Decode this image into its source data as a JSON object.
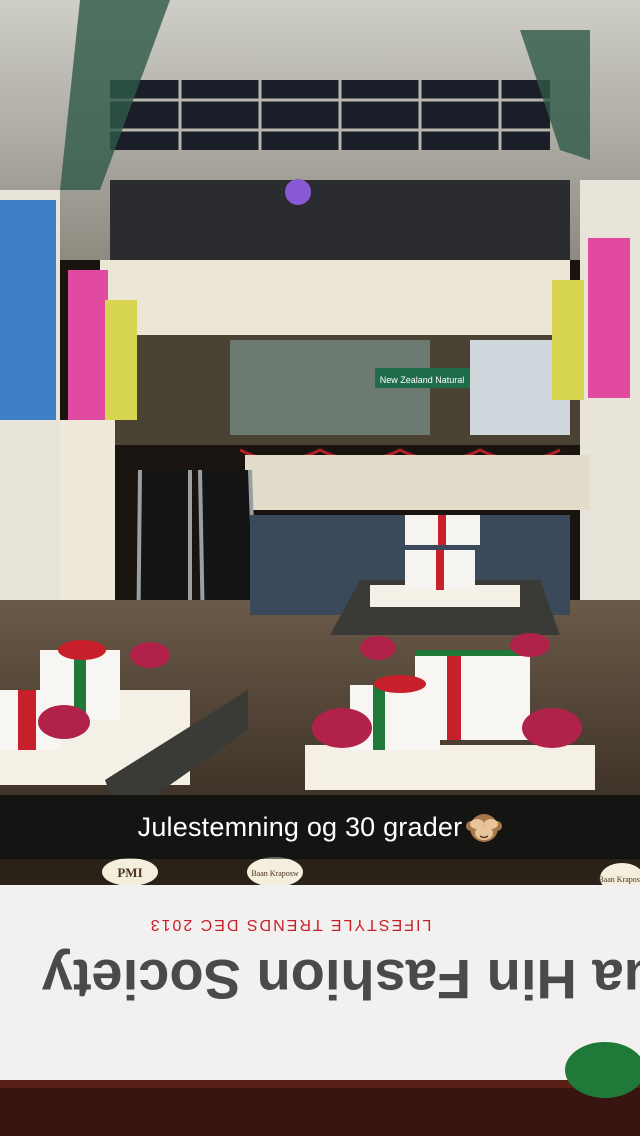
{
  "snap": {
    "caption": "Julestemning og 30 grader",
    "emoji": "see-no-evil-monkey"
  },
  "scene": {
    "store_sign_1": "PMI",
    "store_sign_2": "Baan Kraposw",
    "store_sign_3": "Baan Kraposw",
    "shop_sign": "New Zealand Natural",
    "banner_sub": "LIFESTYLE TRENDS DEC 2013",
    "banner_main_1": "Hua Hin Fashion Society",
    "colors": {
      "gift_red": "#c8202a",
      "gift_green": "#1f7a3a",
      "flowers": "#b0224a",
      "awning": "#3a3a36"
    }
  }
}
